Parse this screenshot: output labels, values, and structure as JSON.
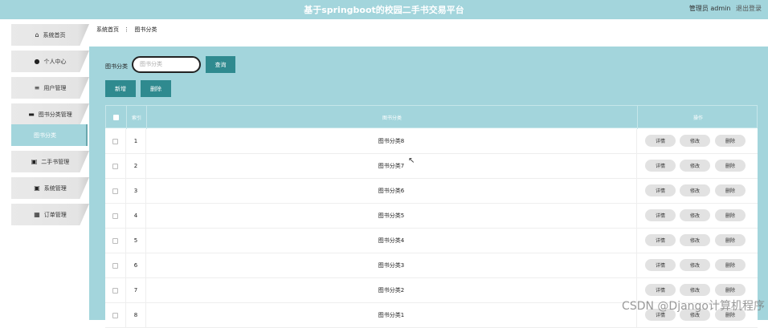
{
  "header": {
    "title": "基于springboot的校园二手书交易平台",
    "user": "管理员 admin",
    "logout": "退出登录"
  },
  "sidebar": {
    "items": [
      {
        "label": "系统首页",
        "icon": "home-icon"
      },
      {
        "label": "个人中心",
        "icon": "user-icon"
      },
      {
        "label": "用户管理",
        "icon": "list-icon"
      },
      {
        "label": "图书分类管理",
        "icon": "briefcase-icon"
      },
      {
        "label": "图书分类",
        "icon": ""
      },
      {
        "label": "二手书管理",
        "icon": "clipboard-icon"
      },
      {
        "label": "系统管理",
        "icon": "clipboard-icon"
      },
      {
        "label": "订单管理",
        "icon": "grid-icon"
      }
    ]
  },
  "breadcrumb": {
    "home": "系统首页",
    "sep": "⋮",
    "current": "图书分类"
  },
  "search": {
    "label": "图书分类",
    "placeholder": "图书分类",
    "query_label": "查询"
  },
  "toolbar": {
    "add_label": "新增",
    "delete_label": "删除"
  },
  "table": {
    "headers": {
      "index": "索引",
      "name": "图书分类",
      "action": "操作"
    },
    "rows": [
      {
        "index": "1",
        "name": "图书分类8"
      },
      {
        "index": "2",
        "name": "图书分类7"
      },
      {
        "index": "3",
        "name": "图书分类6"
      },
      {
        "index": "4",
        "name": "图书分类5"
      },
      {
        "index": "5",
        "name": "图书分类4"
      },
      {
        "index": "6",
        "name": "图书分类3"
      },
      {
        "index": "7",
        "name": "图书分类2"
      },
      {
        "index": "8",
        "name": "图书分类1"
      }
    ],
    "actions": {
      "detail": "详情",
      "edit": "修改",
      "delete": "删除"
    }
  },
  "watermark": "CSDN @Django计算机程序",
  "colors": {
    "accent": "#a3d5dc",
    "button": "#2f8a8f"
  }
}
